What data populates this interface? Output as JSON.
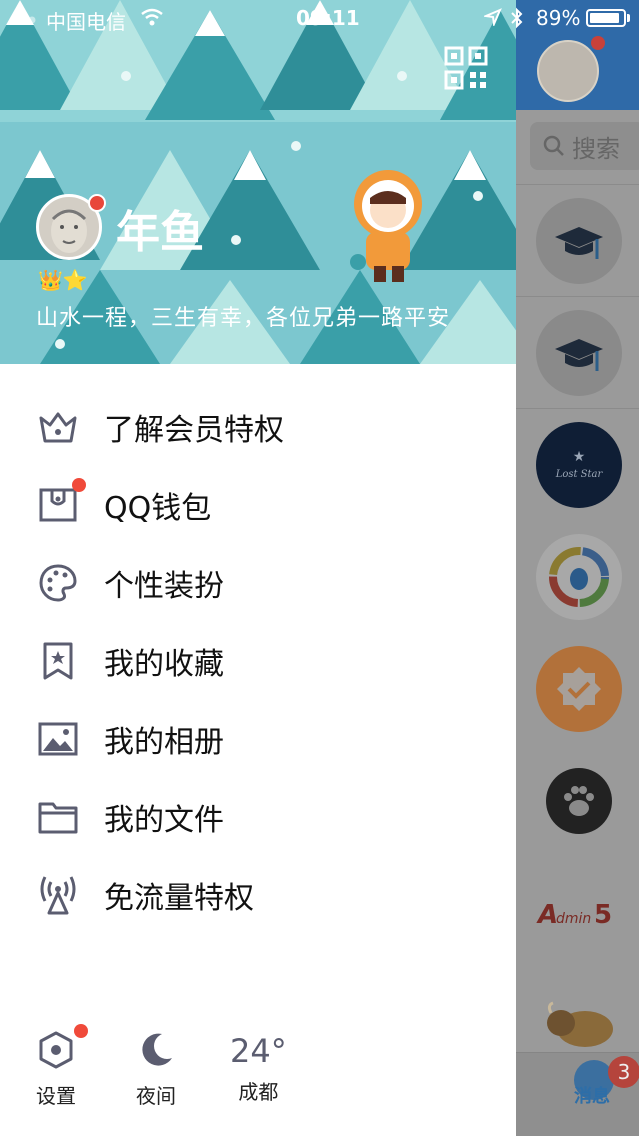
{
  "status_bar": {
    "carrier": "中国电信",
    "time": "09:11",
    "battery": "89%",
    "battery_level": 0.89
  },
  "header": {
    "profile_name": "年鱼",
    "signature": "山水一程，三生有幸，各位兄弟一路平安",
    "vip_badges": "👑⭐"
  },
  "menu": {
    "items": [
      {
        "label": "了解会员特权",
        "icon": "crown-icon",
        "dot": false
      },
      {
        "label": "QQ钱包",
        "icon": "wallet-icon",
        "dot": true
      },
      {
        "label": "个性装扮",
        "icon": "palette-icon",
        "dot": false
      },
      {
        "label": "我的收藏",
        "icon": "bookmark-star-icon",
        "dot": false
      },
      {
        "label": "我的相册",
        "icon": "image-icon",
        "dot": false
      },
      {
        "label": "我的文件",
        "icon": "folder-icon",
        "dot": false
      },
      {
        "label": "免流量特权",
        "icon": "antenna-icon",
        "dot": false
      }
    ]
  },
  "bottom": {
    "settings_label": "设置",
    "night_label": "夜间",
    "temperature": "24°",
    "city": "成都"
  },
  "right_panel": {
    "search_label": "搜索",
    "messages_label": "消息",
    "messages_badge": "3",
    "items": [
      "graduation-cap-icon",
      "graduation-cap-icon",
      "lost-star-avatar",
      "qq-app-icon",
      "verified-badge-icon",
      "paw-icon",
      "admin5-logo",
      "bison-avatar"
    ]
  },
  "colors": {
    "header_bg": "#7cc7cf",
    "accent_red": "#f04a3a",
    "icon_gray": "#5b5d70"
  }
}
